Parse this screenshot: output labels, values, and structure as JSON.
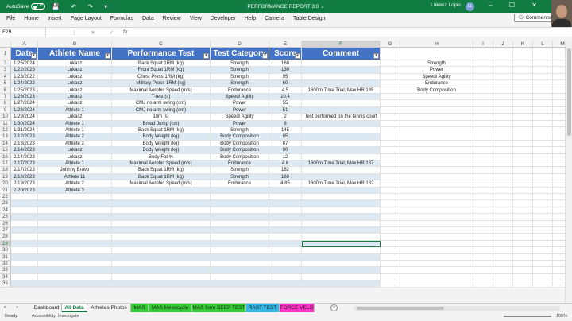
{
  "titlebar": {
    "autosave_label": "AutoSave",
    "autosave_state": "Off",
    "doc_title": "PERFORMANCE REPORT 3.0 ⌄",
    "user_name": "Lukasz Lojas",
    "user_initials": "LL"
  },
  "menu": {
    "tabs": [
      "File",
      "Home",
      "Insert",
      "Page Layout",
      "Formulas",
      "Data",
      "Review",
      "View",
      "Developer",
      "Help",
      "Camera",
      "Table Design"
    ],
    "active_tab": "Data",
    "comments_label": "Comments"
  },
  "formula_bar": {
    "name_box": "F29",
    "fx": "fx",
    "value": ""
  },
  "grid": {
    "columns": [
      "A",
      "B",
      "C",
      "D",
      "E",
      "F",
      "G",
      "H",
      "I",
      "J",
      "K",
      "L",
      "M"
    ],
    "selected_column": "F",
    "selected_row": 29,
    "headers": [
      "Date",
      "Athlete Name",
      "Performance Test",
      "Test Category",
      "Score",
      "Comment"
    ],
    "rows": [
      [
        "1/25/2024",
        "Lukasz",
        "Back Squat 1RM (kg)",
        "Strength",
        "160",
        ""
      ],
      [
        "1/22/2025",
        "Lukasz",
        "Front Squat 1RM (kg)",
        "Strength",
        "130",
        ""
      ],
      [
        "1/23/2022",
        "Lukasz",
        "Chest Press 1RM (kg)",
        "Strength",
        "95",
        ""
      ],
      [
        "1/24/2022",
        "Lukasz",
        "Military Press 1RM (kg)",
        "Strength",
        "60",
        ""
      ],
      [
        "1/25/2023",
        "Lukasz",
        "Maximal Aerobic Speed (m/s)",
        "Endurance",
        "4.5",
        "1600m Time Trial, Max HR 185"
      ],
      [
        "1/26/2023",
        "Lukasz",
        "T-test (s)",
        "Speed/ Agility",
        "10.4",
        ""
      ],
      [
        "1/27/2024",
        "Lukasz",
        "CMJ no arm swing (cm)",
        "Power",
        "55",
        ""
      ],
      [
        "1/28/2024",
        "Athlete 1",
        "CMJ no arm swing (cm)",
        "Power",
        "51",
        ""
      ],
      [
        "1/29/2024",
        "Lukasz",
        "10m (s)",
        "Speed/ Agility",
        "2",
        "Test performed on the tennis court"
      ],
      [
        "1/30/2024",
        "Athlete 1",
        "Broad Jump (cm)",
        "Power",
        "8",
        ""
      ],
      [
        "1/31/2024",
        "Athlete 1",
        "Back Squat 1RM (kg)",
        "Strength",
        "145",
        ""
      ],
      [
        "2/12/2023",
        "Athlete 2",
        "Body Weight (kg)",
        "Body Composition",
        "85",
        ""
      ],
      [
        "2/13/2023",
        "Athlete 2",
        "Body Weight (kg)",
        "Body Composition",
        "87",
        ""
      ],
      [
        "2/14/2023",
        "Lukasz",
        "Body Weight (kg)",
        "Body Composition",
        "90",
        ""
      ],
      [
        "2/14/2023",
        "Lukasz",
        "Body Fat %",
        "Body Composition",
        "12",
        ""
      ],
      [
        "2/17/2023",
        "Athlete 1",
        "Maximal Aerobic Speed (m/s)",
        "Endurance",
        "4.6",
        "1600m Time Trial, Max HR 187"
      ],
      [
        "2/17/2023",
        "Johnny Bravo",
        "Back Squat 1RM (kg)",
        "Strength",
        "182",
        ""
      ],
      [
        "2/18/2023",
        "Athlete 11",
        "Back Squat 1RM (kg)",
        "Strength",
        "160",
        ""
      ],
      [
        "2/19/2023",
        "Athlete 2",
        "Maximal Aerobic Speed (m/s)",
        "Endurance",
        "4.85",
        "1600m Time Trial, Max HR 182"
      ],
      [
        "2/20/2023",
        "Athlete 3",
        "",
        "",
        "",
        ""
      ]
    ],
    "side_list": [
      "Strength",
      "Power",
      "Speed/ Agility",
      "Endurance",
      "Body Composition"
    ]
  },
  "sheet_tabs": [
    {
      "label": "Dashboard",
      "color": "#f3f3f3"
    },
    {
      "label": "All Data",
      "color": "#ffffff"
    },
    {
      "label": "Athletes Photos",
      "color": "#f3f3f3"
    },
    {
      "label": "MAS",
      "color": "#33cc33"
    },
    {
      "label": "MAS Mesocycle",
      "color": "#33cc33"
    },
    {
      "label": "MAS form BEEP TEST",
      "color": "#33cc33"
    },
    {
      "label": "RAST TEST",
      "color": "#33b5e5"
    },
    {
      "label": "FORCE VELO",
      "color": "#ff33cc"
    }
  ],
  "active_sheet": "All Data",
  "status": {
    "ready": "Ready",
    "accessibility": "Accessibility: Investigate",
    "zoom": "100%"
  }
}
